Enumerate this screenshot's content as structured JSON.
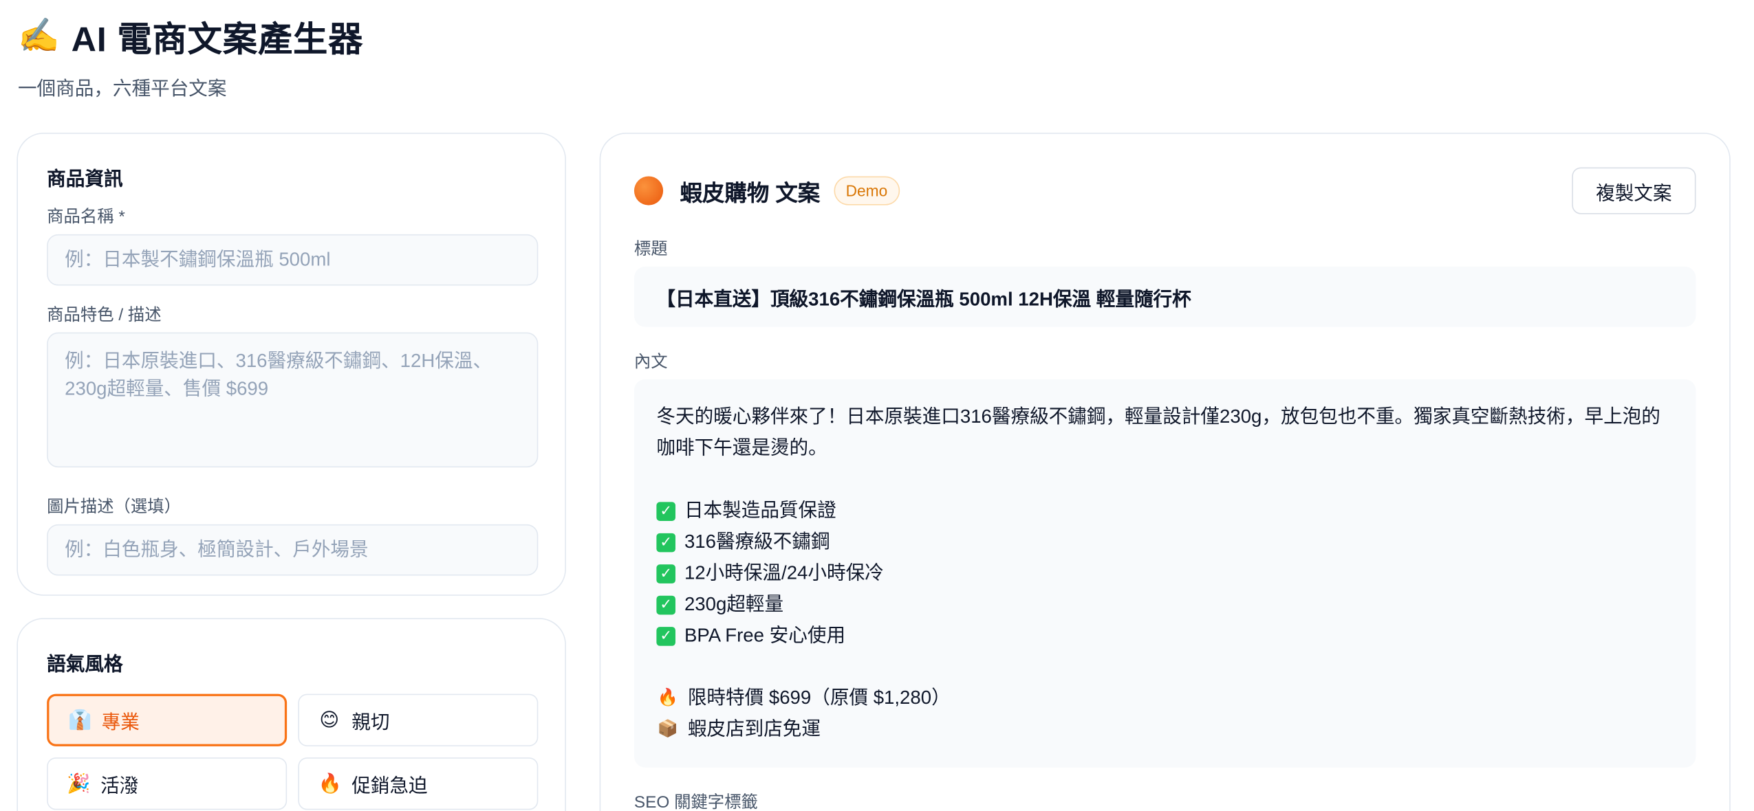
{
  "app": {
    "title": "AI 電商文案產生器",
    "subtitle": "一個商品，六種平台文案"
  },
  "product_form": {
    "heading": "商品資訊",
    "name_label": "商品名稱 *",
    "name_placeholder": "例：日本製不鏽鋼保溫瓶 500ml",
    "features_label": "商品特色 / 描述",
    "features_placeholder": "例：日本原裝進口、316醫療級不鏽鋼、12H保溫、230g超輕量、售價 $699",
    "image_label": "圖片描述（選填）",
    "image_placeholder": "例：白色瓶身、極簡設計、戶外場景"
  },
  "tone": {
    "heading": "語氣風格",
    "options": [
      {
        "label": "專業",
        "icon": "necktie-icon",
        "glyph": "👔",
        "selected": true
      },
      {
        "label": "親切",
        "icon": "smile-icon",
        "glyph": "😊",
        "selected": false
      },
      {
        "label": "活潑",
        "icon": "party-popper-icon",
        "glyph": "🎉",
        "selected": false
      },
      {
        "label": "促銷急迫",
        "icon": "fire-icon",
        "glyph": "🔥",
        "selected": false
      }
    ]
  },
  "result": {
    "platform_title": "蝦皮購物 文案",
    "badge": "Demo",
    "copy_button": "複製文案",
    "title_label": "標題",
    "title_text": "【日本直送】頂級316不鏽鋼保溫瓶 500ml 12H保溫 輕量隨行杯",
    "body_label": "內文",
    "body_intro": "冬天的暖心夥伴來了！日本原裝進口316醫療級不鏽鋼，輕量設計僅230g，放包包也不重。獨家真空斷熱技術，早上泡的咖啡下午還是燙的。",
    "checklist": [
      "日本製造品質保證",
      "316醫療級不鏽鋼",
      "12小時保溫/24小時保冷",
      "230g超輕量",
      "BPA Free 安心使用"
    ],
    "price_line": "限時特價 $699（原價 $1,280）",
    "shipping_line": "蝦皮店到店免運",
    "seo_label": "SEO 關鍵字標籤"
  },
  "colors": {
    "accent": "#f97316",
    "accent_bg": "#fff1e8",
    "check_green": "#22c55e",
    "badge_text": "#d97706"
  }
}
